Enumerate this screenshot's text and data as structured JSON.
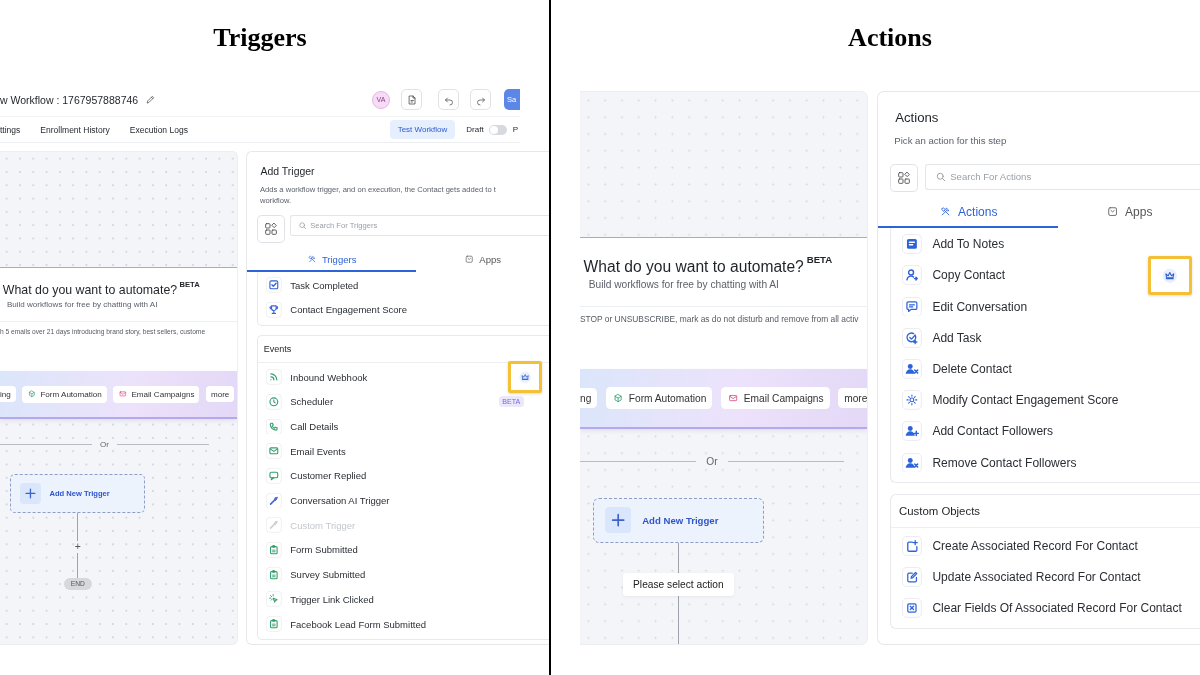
{
  "panels": [
    {
      "kind": "triggers",
      "caption": "Triggers",
      "header": {
        "title": "w Workflow : 1767957888746",
        "avatar": "VA",
        "save_button": "Sa",
        "nav_tabs": [
          {
            "label": "ttings"
          },
          {
            "label": "Enrollment History"
          },
          {
            "label": "Execution Logs"
          }
        ],
        "test_button": "Test Workflow",
        "draft": {
          "label": "Draft",
          "on": false
        },
        "publish_label": "P"
      },
      "canvas": {
        "ai_title": "What do you want to automate?",
        "ai_badge": "BETA",
        "ai_subtitle": "Build workflows for free by chatting with AI",
        "prompt": "h 5 emails over 21 days introducing brand story, best sellers, custome",
        "chips": [
          {
            "label": "ing",
            "kind": "plain"
          },
          {
            "label": "Form Automation",
            "kind": "cube"
          },
          {
            "label": "Email Campaigns",
            "kind": "mail"
          },
          {
            "label": "more",
            "kind": "plain"
          }
        ],
        "or_label": "Or",
        "add_trigger": "Add New Trigger",
        "flow": [
          {
            "kind": "plus",
            "text": "+"
          },
          {
            "kind": "end",
            "text": "END"
          }
        ]
      },
      "side": {
        "title": "Add Trigger",
        "description": [
          "Adds a workflow trigger, and on execution, the Contact gets added to t",
          "workflow."
        ],
        "search_placeholder": "Search For Triggers",
        "tabs": [
          {
            "label": "Triggers",
            "kind": "tools",
            "selected": true
          },
          {
            "label": "Apps",
            "kind": "box",
            "selected": false
          }
        ],
        "sections": [
          {
            "items": [
              {
                "label": "Task Completed",
                "kind": "check",
                "disabled": false,
                "premium": false
              },
              {
                "label": "Contact Engagement Score",
                "kind": "trophy",
                "disabled": false,
                "premium": false
              }
            ]
          },
          {
            "heading": "Events",
            "items": [
              {
                "label": "Inbound Webhook",
                "kind": "rss",
                "disabled": false,
                "premium": true
              },
              {
                "label": "Scheduler",
                "kind": "clock",
                "disabled": false,
                "premium": false,
                "badge": "BETA"
              },
              {
                "label": "Call Details",
                "kind": "phone",
                "disabled": false,
                "premium": false
              },
              {
                "label": "Email Events",
                "kind": "mail",
                "disabled": false,
                "premium": false
              },
              {
                "label": "Customer Replied",
                "kind": "chat",
                "disabled": false,
                "premium": false
              },
              {
                "label": "Conversation AI Trigger",
                "kind": "sparkle",
                "disabled": false,
                "premium": false
              },
              {
                "label": "Custom Trigger",
                "kind": "sparkle",
                "disabled": true,
                "premium": false
              },
              {
                "label": "Form Submitted",
                "kind": "clipboard",
                "disabled": false,
                "premium": false
              },
              {
                "label": "Survey Submitted",
                "kind": "clipboard",
                "disabled": false,
                "premium": false
              },
              {
                "label": "Trigger Link Clicked",
                "kind": "cursor",
                "disabled": false,
                "premium": false
              },
              {
                "label": "Facebook Lead Form Submitted",
                "kind": "clipboard",
                "disabled": false,
                "premium": false
              }
            ]
          }
        ]
      }
    },
    {
      "kind": "actions",
      "caption": "Actions",
      "canvas": {
        "ai_title": "What do you want to automate?",
        "ai_badge": "BETA",
        "ai_subtitle": "Build workflows for free by chatting with AI",
        "prompt": "STOP or UNSUBSCRIBE, mark as do not disturb and remove from all activ",
        "chips": [
          {
            "label": "ng",
            "kind": "plain"
          },
          {
            "label": "Form Automation",
            "kind": "cube"
          },
          {
            "label": "Email Campaigns",
            "kind": "mail"
          },
          {
            "label": "more",
            "kind": "plain"
          }
        ],
        "or_label": "Or",
        "add_trigger": "Add New Trigger",
        "flow": [
          {
            "kind": "step",
            "text": "Please select action"
          }
        ]
      },
      "side": {
        "title": "Actions",
        "description": [
          "Pick an action for this step"
        ],
        "search_placeholder": "Search For Actions",
        "tabs": [
          {
            "label": "Actions",
            "kind": "tools",
            "selected": true
          },
          {
            "label": "Apps",
            "kind": "box",
            "selected": false
          }
        ],
        "sections": [
          {
            "items": [
              {
                "label": "Add To Notes",
                "kind": "note",
                "premium": false
              },
              {
                "label": "Copy Contact",
                "kind": "userarrow",
                "premium": true
              },
              {
                "label": "Edit Conversation",
                "kind": "message",
                "premium": false
              },
              {
                "label": "Add Task",
                "kind": "task",
                "premium": false
              },
              {
                "label": "Delete Contact",
                "kind": "userx",
                "premium": false
              },
              {
                "label": "Modify Contact Engagement Score",
                "kind": "sun",
                "premium": false
              },
              {
                "label": "Add Contact Followers",
                "kind": "useradd",
                "premium": false
              },
              {
                "label": "Remove Contact Followers",
                "kind": "userx",
                "premium": false
              }
            ]
          },
          {
            "heading": "Custom Objects",
            "items": [
              {
                "label": "Create Associated Record For Contact",
                "kind": "sqplus",
                "premium": false
              },
              {
                "label": "Update Associated Record For Contact",
                "kind": "sqedit",
                "premium": false
              },
              {
                "label": "Clear Fields Of Associated Record For Contact",
                "kind": "sqx",
                "premium": false
              }
            ]
          }
        ]
      }
    }
  ]
}
